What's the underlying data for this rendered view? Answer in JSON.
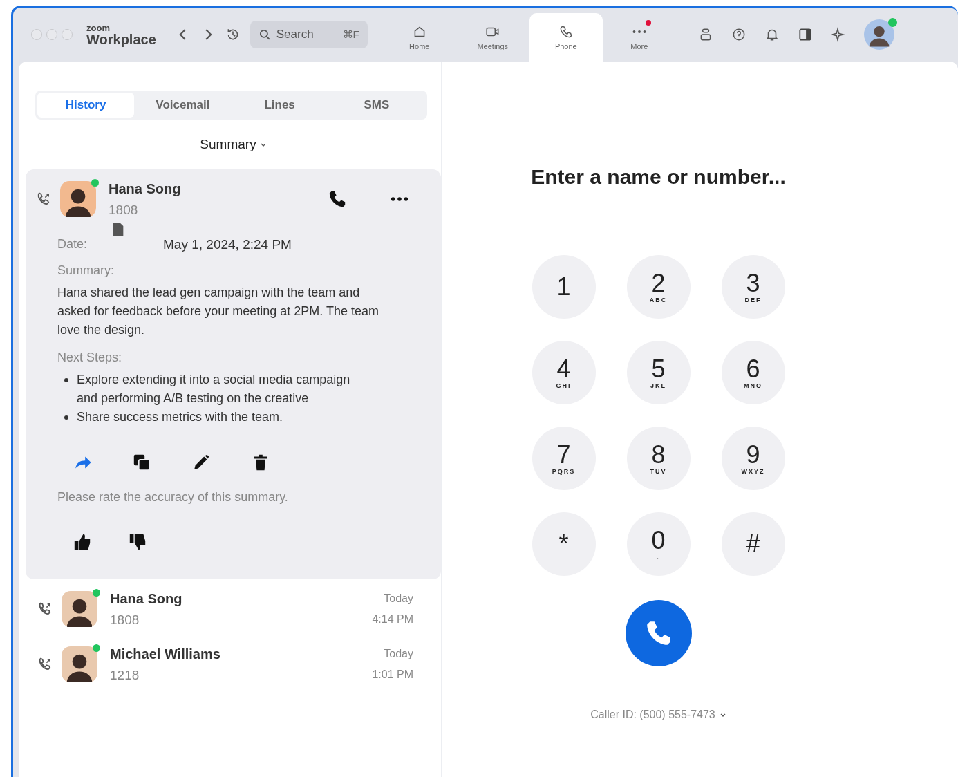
{
  "titlebar": {
    "brand_small": "zoom",
    "brand": "Workplace",
    "search": {
      "placeholder": "Search",
      "shortcut": "⌘F"
    },
    "nav": [
      {
        "label": "Home",
        "kind": "home",
        "selected": false,
        "badge": false
      },
      {
        "label": "Meetings",
        "kind": "video",
        "selected": false,
        "badge": false
      },
      {
        "label": "Phone",
        "kind": "phone",
        "selected": true,
        "badge": false
      },
      {
        "label": "More",
        "kind": "more",
        "selected": false,
        "badge": true
      }
    ],
    "user": {
      "online": true
    }
  },
  "tabs": [
    {
      "label": "History",
      "selected": true
    },
    {
      "label": "Voicemail",
      "selected": false
    },
    {
      "label": "Lines",
      "selected": false
    },
    {
      "label": "SMS",
      "selected": false
    }
  ],
  "filter": "Summary",
  "expanded_call": {
    "name": "Hana Song",
    "extension": "1808",
    "online": true,
    "date_label": "Date:",
    "date": "May 1, 2024, 2:24 PM",
    "summary_label": "Summary:",
    "summary": "Hana shared the lead gen campaign with the team and asked for feedback before your meeting at 2PM. The team love the design.",
    "next_steps_label": "Next Steps:",
    "next_steps": [
      "Explore extending it into a social media campaign and performing A/B testing on the creative",
      "Share success metrics with the team."
    ],
    "rating_prompt": "Please rate the accuracy of this summary."
  },
  "calls": [
    {
      "name": "Hana Song",
      "extension": "1808",
      "day": "Today",
      "time": "4:14 PM",
      "online": true
    },
    {
      "name": "Michael Williams",
      "extension": "1218",
      "day": "Today",
      "time": "1:01 PM",
      "online": true
    }
  ],
  "dialer": {
    "prompt": "Enter a name or number...",
    "keys": [
      {
        "digit": "1"
      },
      {
        "digit": "2",
        "letters": "ABC"
      },
      {
        "digit": "3",
        "letters": "DEF"
      },
      {
        "digit": "4",
        "letters": "GHI"
      },
      {
        "digit": "5",
        "letters": "JKL"
      },
      {
        "digit": "6",
        "letters": "MNO"
      },
      {
        "digit": "7",
        "letters": "PQRS"
      },
      {
        "digit": "8",
        "letters": "TUV"
      },
      {
        "digit": "9",
        "letters": "WXYZ"
      },
      {
        "digit": "*"
      },
      {
        "digit": "0",
        "letters": "."
      },
      {
        "digit": "#"
      }
    ],
    "caller_id": "Caller ID: (500) 555-7473"
  }
}
